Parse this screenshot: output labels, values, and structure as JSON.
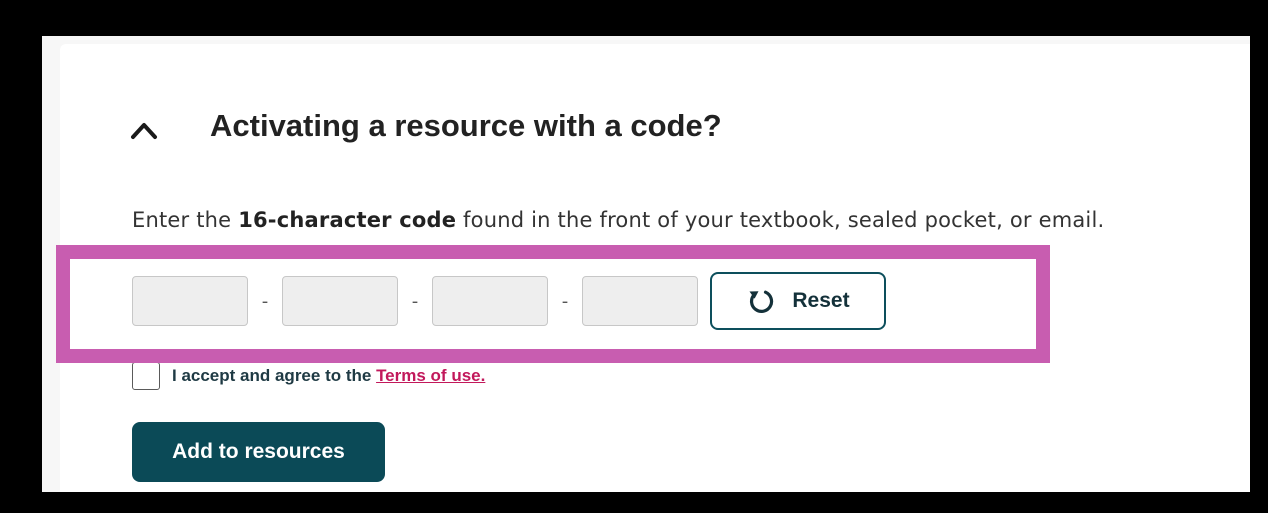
{
  "section": {
    "heading": "Activating a resource with a code?",
    "instructions": {
      "prefix": "Enter the ",
      "bold": "16-character code",
      "suffix": " found in the front of your textbook, sealed pocket, or email."
    }
  },
  "code_entry": {
    "separator": "-",
    "segments": [
      {
        "value": "",
        "placeholder": ""
      },
      {
        "value": "",
        "placeholder": ""
      },
      {
        "value": "",
        "placeholder": ""
      },
      {
        "value": "",
        "placeholder": ""
      }
    ],
    "reset_label": "Reset"
  },
  "terms": {
    "checked": false,
    "text": "I accept and agree to the ",
    "link_text": "Terms of use."
  },
  "add_button_label": "Add to resources",
  "colors": {
    "primary": "#0b4a57",
    "link": "#c2185b",
    "highlight": "#c85db0",
    "input_bg": "#eeeeee"
  },
  "icons": {
    "toggle": "chevron-up-icon",
    "reset": "reset-icon"
  }
}
